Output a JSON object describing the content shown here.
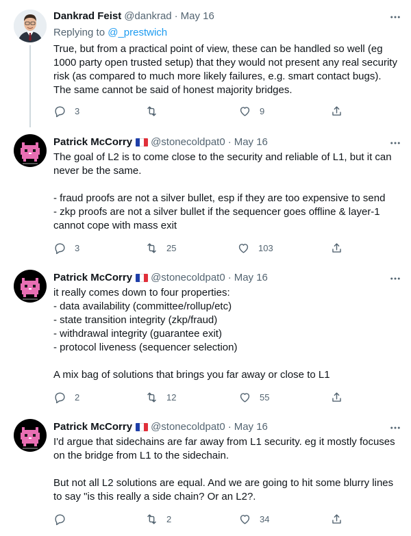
{
  "tweets": [
    {
      "name": "Dankrad Feist",
      "handle": "@dankrad",
      "sep": "·",
      "date": "May 16",
      "replying_prefix": "Replying to",
      "replying_to": "@_prestwich",
      "text": "True, but from a practical point of view, these can be handled so well (eg 1000 party open trusted setup) that they would not present any real security risk (as compared to much more likely failures, e.g. smart contact bugs). The same cannot be said of honest majority bridges.",
      "replies": "3",
      "retweets": "",
      "likes": "9"
    },
    {
      "name": "Patrick McCorry",
      "handle": "@stonecoldpat0",
      "sep": "·",
      "date": "May 16",
      "text": "The goal of L2 is to come close to the security and reliable of L1, but it can never be the same.\n\n- fraud proofs are not a silver bullet, esp if they are too expensive to send\n- zkp proofs are not a silver bullet if the sequencer goes offline & layer-1 cannot cope with mass exit",
      "replies": "3",
      "retweets": "25",
      "likes": "103"
    },
    {
      "name": "Patrick McCorry",
      "handle": "@stonecoldpat0",
      "sep": "·",
      "date": "May 16",
      "text": "it really comes down to four properties:\n- data availability (committee/rollup/etc)\n- state transition integrity (zkp/fraud)\n- withdrawal integrity (guarantee exit)\n- protocol liveness (sequencer selection)\n\nA mix bag of solutions that brings you far away or close to L1",
      "replies": "2",
      "retweets": "12",
      "likes": "55"
    },
    {
      "name": "Patrick McCorry",
      "handle": "@stonecoldpat0",
      "sep": "·",
      "date": "May 16",
      "text": "I'd argue that sidechains are far away from L1 security. eg it mostly focuses on the bridge from L1 to the sidechain.\n\nBut not all L2 solutions are equal. And we are going to hit some blurry lines to say \"is this really a side chain? Or an L2?.",
      "replies": "",
      "retweets": "2",
      "likes": "34"
    }
  ],
  "colors": {
    "text": "#0f1419",
    "muted": "#536471",
    "link": "#1d9bf0",
    "thread_line": "#cfd9de",
    "flag_blue": "#1f3fa8",
    "flag_white": "#ffffff",
    "flag_red": "#e0303a"
  },
  "icons": [
    "reply-icon",
    "retweet-icon",
    "like-icon",
    "share-icon",
    "more-icon",
    "flag-fr-icon"
  ]
}
